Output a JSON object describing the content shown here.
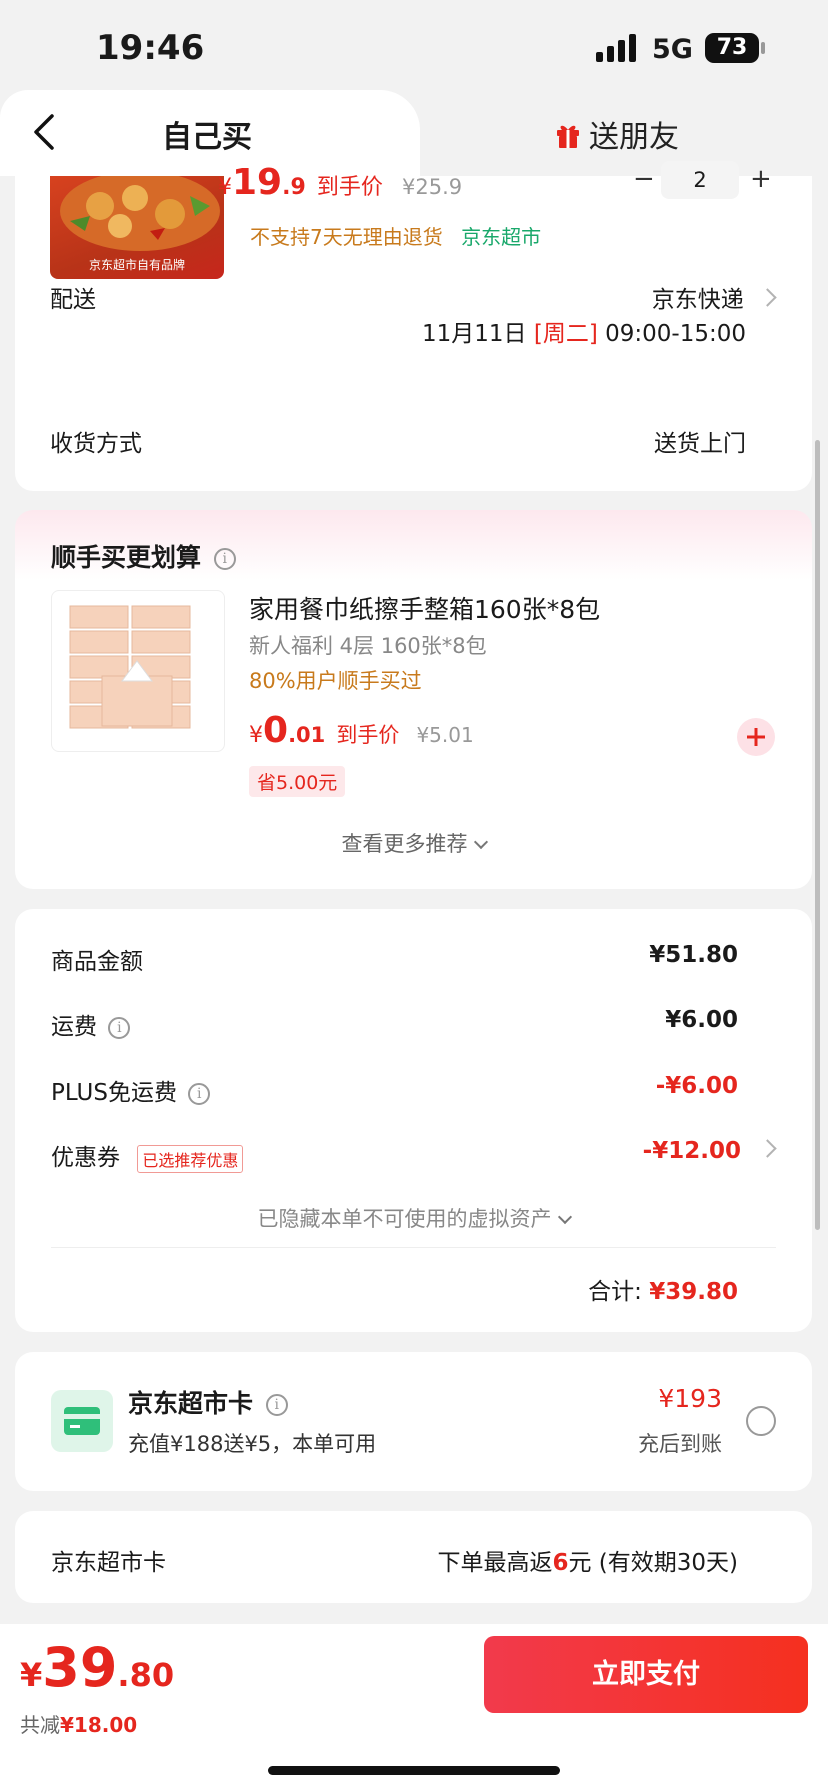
{
  "status_bar": {
    "time": "19:46",
    "network": "5G",
    "battery": "73"
  },
  "tabs": {
    "self_buy": "自己买",
    "gift_friend": "送朋友"
  },
  "product": {
    "price_symbol": "¥",
    "price_int": "19",
    "price_dec": ".9",
    "price_tag": "到手价",
    "orig_price": "¥25.9",
    "quantity": "2",
    "minus": "−",
    "plus": "+",
    "no_return_note": "不支持7天无理由退货",
    "store_tag": "京东超市",
    "image_badge": "京东超市自有品牌"
  },
  "delivery": {
    "label": "配送",
    "carrier": "京东快递",
    "date": "11月11日",
    "weekday": "[周二]",
    "time_range": "09:00-15:00"
  },
  "receive": {
    "label": "收货方式",
    "value": "送货上门"
  },
  "addon": {
    "section_title": "顺手买更划算",
    "item_title": "家用餐巾纸擦手整箱160张*8包",
    "item_sub": "新人福利 4层 160张*8包",
    "item_stat": "80%用户顺手买过",
    "price_symbol": "¥",
    "price_int": "0",
    "price_dec": ".01",
    "price_tag": "到手价",
    "orig_price": "¥5.01",
    "save_badge": "省5.00元",
    "more": "查看更多推荐"
  },
  "summary": {
    "goods_label": "商品金额",
    "goods_value": "¥51.80",
    "shipping_label": "运费",
    "shipping_value": "¥6.00",
    "plus_label": "PLUS免运费",
    "plus_value": "-¥6.00",
    "coupon_label": "优惠券",
    "coupon_tag": "已选推荐优惠",
    "coupon_value": "-¥12.00",
    "hidden_assets": "已隐藏本单不可使用的虚拟资产",
    "total_label": "合计:",
    "total_value": "¥39.80"
  },
  "card_offer": {
    "title": "京东超市卡",
    "desc": "充值¥188送¥5，本单可用",
    "amount": "¥193",
    "amount_note": "充后到账"
  },
  "card_rebate": {
    "label": "京东超市卡",
    "text_pre": "下单最高返",
    "text_num": "6",
    "text_post": "元 (有效期30天)"
  },
  "footer": {
    "price_symbol": "¥",
    "price_int": "39",
    "price_dec": ".80",
    "saved_label": "共减",
    "saved_value": "¥18.00",
    "pay_button": "立即支付"
  },
  "colors": {
    "accent": "#e5261e",
    "orange": "#c87a1c",
    "green": "#1aa86b"
  }
}
